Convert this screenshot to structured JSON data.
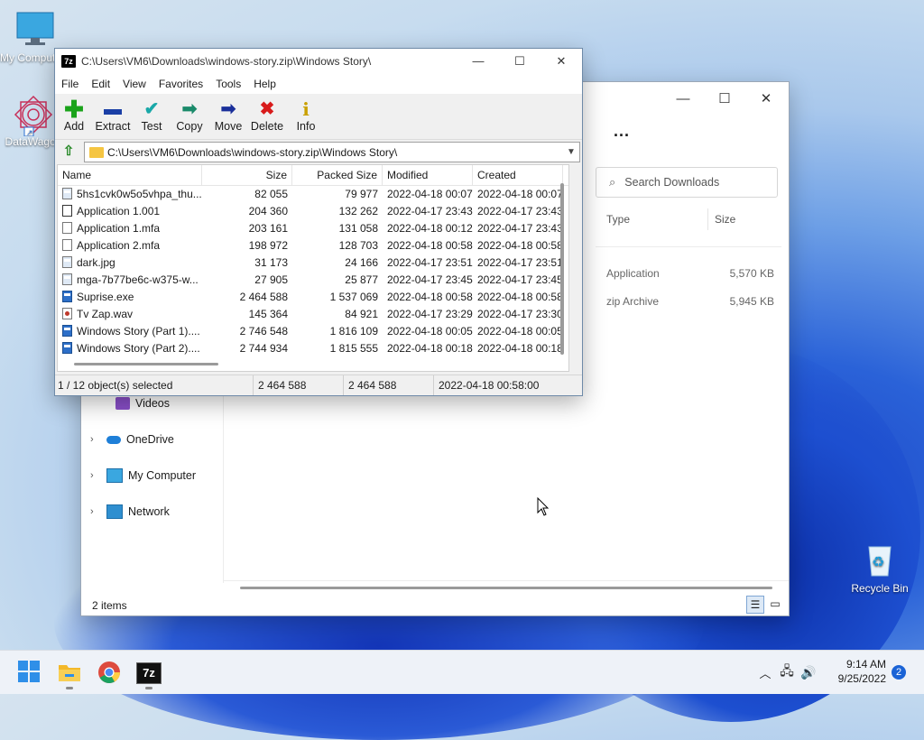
{
  "desktop": {
    "icons": [
      {
        "label": "My Computer"
      },
      {
        "label": "DataWagon"
      },
      {
        "label": "Recycle Bin"
      }
    ]
  },
  "explorer": {
    "search_placeholder": "Search Downloads",
    "more_label": "...",
    "columns": {
      "type": "Type",
      "size": "Size"
    },
    "files": [
      {
        "type": "Application",
        "size": "5,570 KB"
      },
      {
        "type": "zip Archive",
        "size": "5,945 KB"
      }
    ],
    "nav": [
      {
        "label": "Videos"
      },
      {
        "label": "OneDrive"
      },
      {
        "label": "My Computer"
      },
      {
        "label": "Network"
      }
    ],
    "status": "2 items"
  },
  "sevenzip": {
    "title": "C:\\Users\\VM6\\Downloads\\windows-story.zip\\Windows Story\\",
    "address": "C:\\Users\\VM6\\Downloads\\windows-story.zip\\Windows Story\\",
    "logo": "7z",
    "menu": [
      "File",
      "Edit",
      "View",
      "Favorites",
      "Tools",
      "Help"
    ],
    "toolbar": [
      {
        "label": "Add",
        "icon": "add-icon",
        "color": "#1aa31a"
      },
      {
        "label": "Extract",
        "icon": "extract-icon",
        "color": "#1a3fa6"
      },
      {
        "label": "Test",
        "icon": "test-icon",
        "color": "#19a8a8"
      },
      {
        "label": "Copy",
        "icon": "copy-icon",
        "color": "#1a8a6a"
      },
      {
        "label": "Move",
        "icon": "move-icon",
        "color": "#1a2f9a"
      },
      {
        "label": "Delete",
        "icon": "delete-icon",
        "color": "#d81b1b"
      },
      {
        "label": "Info",
        "icon": "info-icon",
        "color": "#c9a000"
      }
    ],
    "columns": {
      "name": "Name",
      "size": "Size",
      "packed": "Packed Size",
      "modified": "Modified",
      "created": "Created"
    },
    "rows": [
      {
        "name": "5hs1cvk0w5o5vhpa_thu...",
        "size": "82 055",
        "packed": "79 977",
        "modified": "2022-04-18 00:07",
        "created": "2022-04-18 00:07",
        "icon": "img"
      },
      {
        "name": "Application 1.001",
        "size": "204 360",
        "packed": "132 262",
        "modified": "2022-04-17 23:43",
        "created": "2022-04-17 23:43",
        "icon": "app"
      },
      {
        "name": "Application 1.mfa",
        "size": "203 161",
        "packed": "131 058",
        "modified": "2022-04-18 00:12",
        "created": "2022-04-17 23:43",
        "icon": "doc"
      },
      {
        "name": "Application 2.mfa",
        "size": "198 972",
        "packed": "128 703",
        "modified": "2022-04-18 00:58",
        "created": "2022-04-18 00:58",
        "icon": "doc"
      },
      {
        "name": "dark.jpg",
        "size": "31 173",
        "packed": "24 166",
        "modified": "2022-04-17 23:51",
        "created": "2022-04-17 23:51",
        "icon": "img"
      },
      {
        "name": "mga-7b77be6c-w375-w...",
        "size": "27 905",
        "packed": "25 877",
        "modified": "2022-04-17 23:45",
        "created": "2022-04-17 23:45",
        "icon": "img"
      },
      {
        "name": "Suprise.exe",
        "size": "2 464 588",
        "packed": "1 537 069",
        "modified": "2022-04-18 00:58",
        "created": "2022-04-18 00:58",
        "icon": "exe"
      },
      {
        "name": "Tv Zap.wav",
        "size": "145 364",
        "packed": "84 921",
        "modified": "2022-04-17 23:29",
        "created": "2022-04-17 23:30",
        "icon": "wav"
      },
      {
        "name": "Windows Story (Part 1)....",
        "size": "2 746 548",
        "packed": "1 816 109",
        "modified": "2022-04-18 00:05",
        "created": "2022-04-18 00:05",
        "icon": "exe"
      },
      {
        "name": "Windows Story (Part 2)....",
        "size": "2 744 934",
        "packed": "1 815 555",
        "modified": "2022-04-18 00:18",
        "created": "2022-04-18 00:18",
        "icon": "exe"
      }
    ],
    "status": {
      "selection": "1 / 12 object(s) selected",
      "size": "2 464 588",
      "packed": "2 464 588",
      "date": "2022-04-18 00:58:00"
    }
  },
  "taskbar": {
    "time": "9:14 AM",
    "date": "9/25/2022",
    "notification_count": "2",
    "pinned": [
      "start-icon",
      "file-explorer-icon",
      "chrome-icon",
      "7zip-icon"
    ]
  }
}
